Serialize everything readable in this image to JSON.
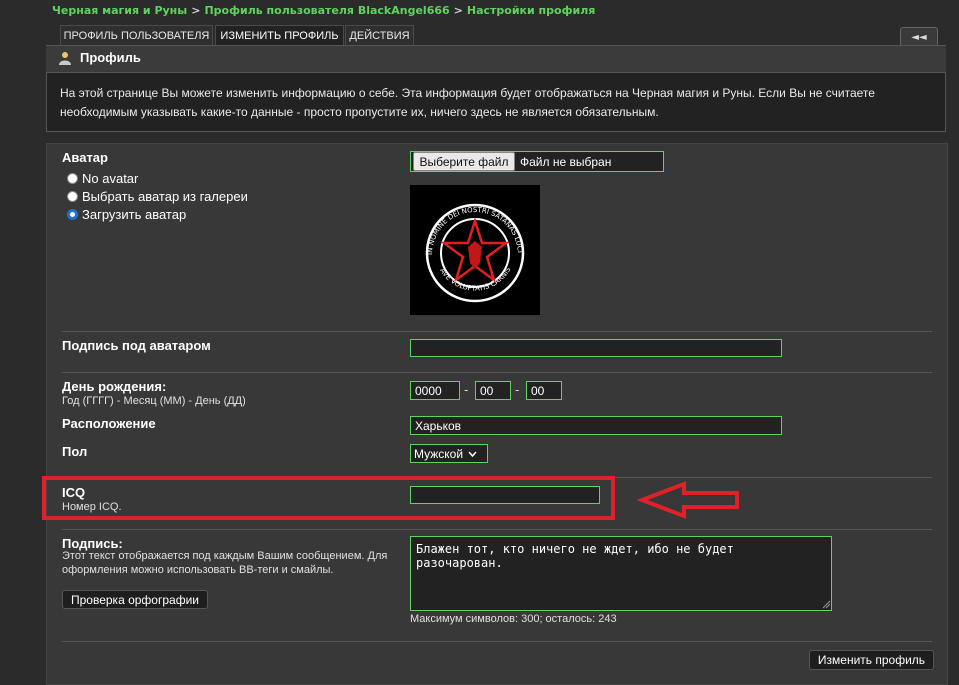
{
  "breadcrumb": {
    "items": [
      "Черная магия и Руны",
      "Профиль пользователя BlackAngel666",
      "Настройки профиля"
    ],
    "separator": ">"
  },
  "tabs": [
    "ПРОФИЛЬ ПОЛЬЗОВАТЕЛЯ",
    "ИЗМЕНИТЬ ПРОФИЛЬ",
    "ДЕЙСТВИЯ"
  ],
  "collapse_label": "◄◄",
  "profile": {
    "title": "Профиль",
    "info": "На этой странице Вы можете изменить информацию о себе. Эта информация будет отображаться на Черная магия и Руны. Если Вы не считаете необходимым указывать какие-то данные - просто пропустите их, ничего здесь не является обязательным."
  },
  "avatar": {
    "label": "Аватар",
    "options": [
      "No avatar",
      "Выбрать аватар из галереи",
      "Загрузить аватар"
    ],
    "selected": 2,
    "file_button": "Выберите файл",
    "file_status": "Файл не выбран",
    "image_text_top": "IN NOMINE DEI NOSTRI SATANAS LUCIFERI EXCELSI",
    "image_text_bottom": "AVE VOLUPTATIS CARNIS"
  },
  "avatar_caption": {
    "label": "Подпись под аватаром",
    "value": ""
  },
  "birthday": {
    "label": "День рождения:",
    "hint": "Год (ГГГГ) - Месяц (ММ) - День (ДД)",
    "year": "0000",
    "month": "00",
    "day": "00",
    "sep": "-"
  },
  "location": {
    "label": "Расположение",
    "value": "Харьков"
  },
  "gender": {
    "label": "Пол",
    "value": "Мужской"
  },
  "icq": {
    "label": "ICQ",
    "hint": "Номер ICQ.",
    "value": ""
  },
  "signature": {
    "label": "Подпись:",
    "hint": "Этот текст отображается под каждым Вашим сообщением. Для оформления можно использовать BB-теги и смайлы.",
    "spellcheck": "Проверка орфографии",
    "value": "Блажен тот, кто ничего не ждет, ибо не будет разочарован.",
    "counter": "Максимум символов: 300; осталось: 243"
  },
  "submit_label": "Изменить профиль",
  "colors": {
    "accent_green": "#5fd35f",
    "highlight_red": "#e0212a",
    "background": "#2b2b2b"
  }
}
